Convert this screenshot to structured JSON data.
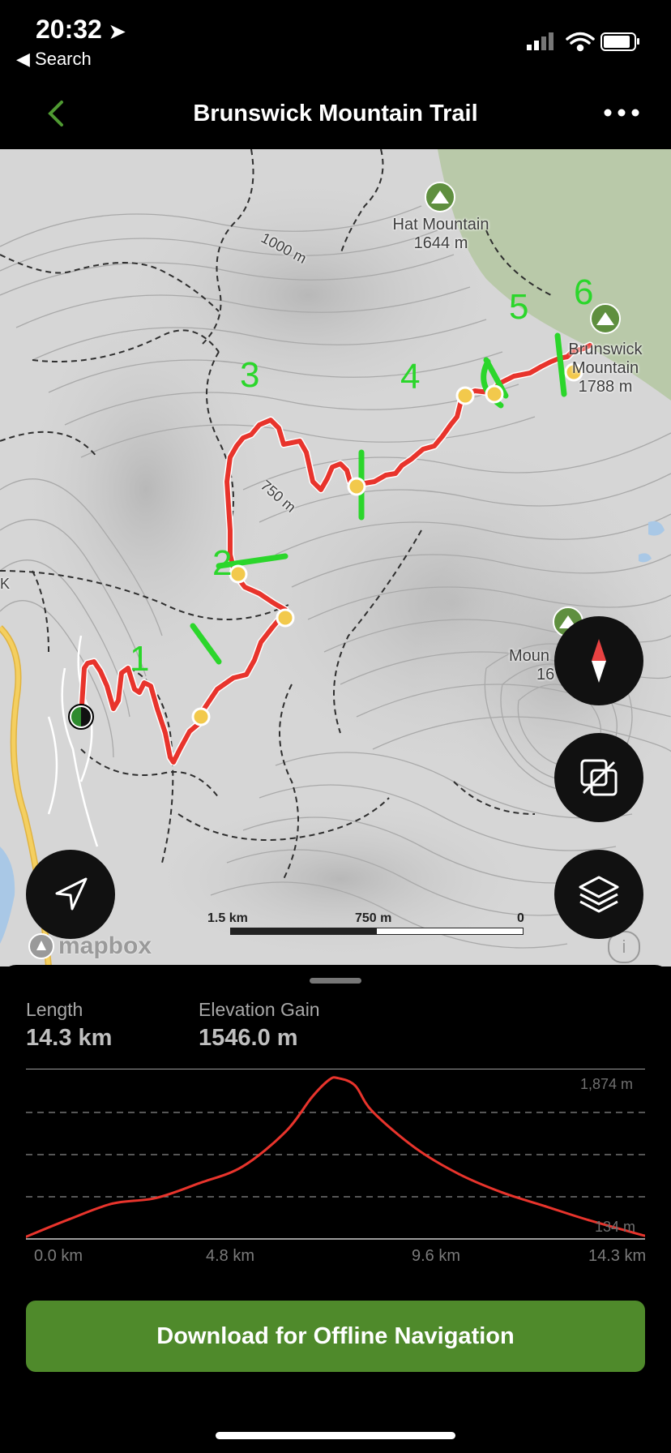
{
  "status_bar": {
    "time": "20:32",
    "back_label": "◀ Search"
  },
  "nav": {
    "title": "Brunswick Mountain Trail"
  },
  "map": {
    "peaks": [
      {
        "name": "Hat Mountain",
        "elevation": "1644 m"
      },
      {
        "name": "Brunswick",
        "name2": "Mountain",
        "elevation": "1788 m"
      },
      {
        "name": "Moun",
        "elevation": "16"
      }
    ],
    "contour_labels": [
      "1000 m",
      "750 m"
    ],
    "segment_numbers": [
      "1",
      "2",
      "3",
      "4",
      "5",
      "6"
    ],
    "scale": {
      "left": "1.5 km",
      "mid": "750 m",
      "right": "0"
    },
    "attribution": "mapbox",
    "info_badge": "i",
    "left_edge_label": "K",
    "route_color": "#e8342c",
    "marker_color": "#2bd62b",
    "waypoint_color": "#f2c94c"
  },
  "stats": {
    "length_label": "Length",
    "length_value": "14.3 km",
    "gain_label": "Elevation Gain",
    "gain_value": "1546.0 m"
  },
  "chart_data": {
    "type": "area",
    "ylabel_top": "1,874 m",
    "ylabel_bottom": "134 m",
    "xtick_labels": [
      "0.0 km",
      "4.8 km",
      "9.6 km",
      "14.3 km"
    ],
    "ylim": [
      134,
      1874
    ],
    "grid": "dashed horizontal",
    "x": [
      0,
      1,
      2,
      3,
      4,
      5,
      6,
      6.6,
      7,
      7.2,
      7.6,
      8,
      9,
      10,
      11,
      12,
      13,
      14.3
    ],
    "y": [
      140,
      330,
      500,
      560,
      720,
      900,
      1280,
      1650,
      1840,
      1860,
      1780,
      1500,
      1100,
      820,
      620,
      470,
      320,
      150
    ],
    "series": [
      {
        "color": "#e8342c"
      }
    ]
  },
  "download_button": "Download for Offline Navigation"
}
